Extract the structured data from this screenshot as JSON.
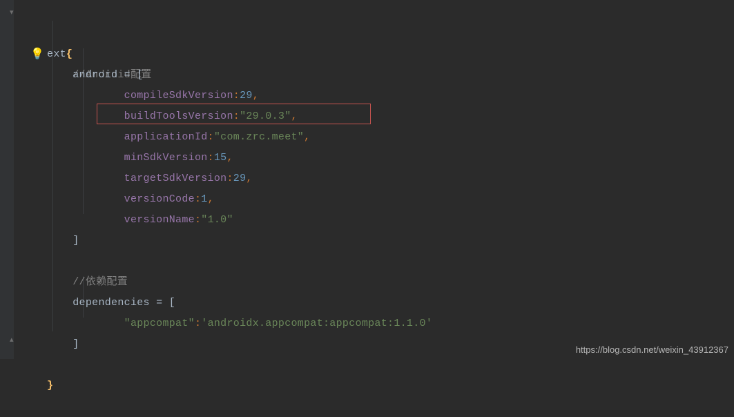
{
  "code": {
    "ext_keyword": "ext",
    "open_brace": "{",
    "close_brace": "}",
    "comment_android": "//Android配置",
    "android_ident": "android",
    "eq": " = ",
    "open_bracket": "[",
    "close_bracket": "]",
    "entries": {
      "compileSdkVersion": {
        "key": "compileSdkVersion",
        "value": "29",
        "type": "num"
      },
      "buildToolsVersion": {
        "key": "buildToolsVersion",
        "value": "\"29.0.3\"",
        "type": "str"
      },
      "applicationId": {
        "key": "applicationId",
        "value": "\"com.zrc.meet\"",
        "type": "str"
      },
      "minSdkVersion": {
        "key": "minSdkVersion",
        "value": "15",
        "type": "num"
      },
      "targetSdkVersion": {
        "key": "targetSdkVersion",
        "value": "29",
        "type": "num"
      },
      "versionCode": {
        "key": "versionCode",
        "value": "1",
        "type": "num"
      },
      "versionName": {
        "key": "versionName",
        "value": "\"1.0\"",
        "type": "str"
      }
    },
    "comment_deps": "//依赖配置",
    "deps_ident": "dependencies",
    "deps_entry": {
      "key": "\"appcompat\"",
      "value": "'androidx.appcompat:appcompat:1.1.0'"
    },
    "comma": ",",
    "colon": ":"
  },
  "watermark": "https://blog.csdn.net/weixin_43912367"
}
